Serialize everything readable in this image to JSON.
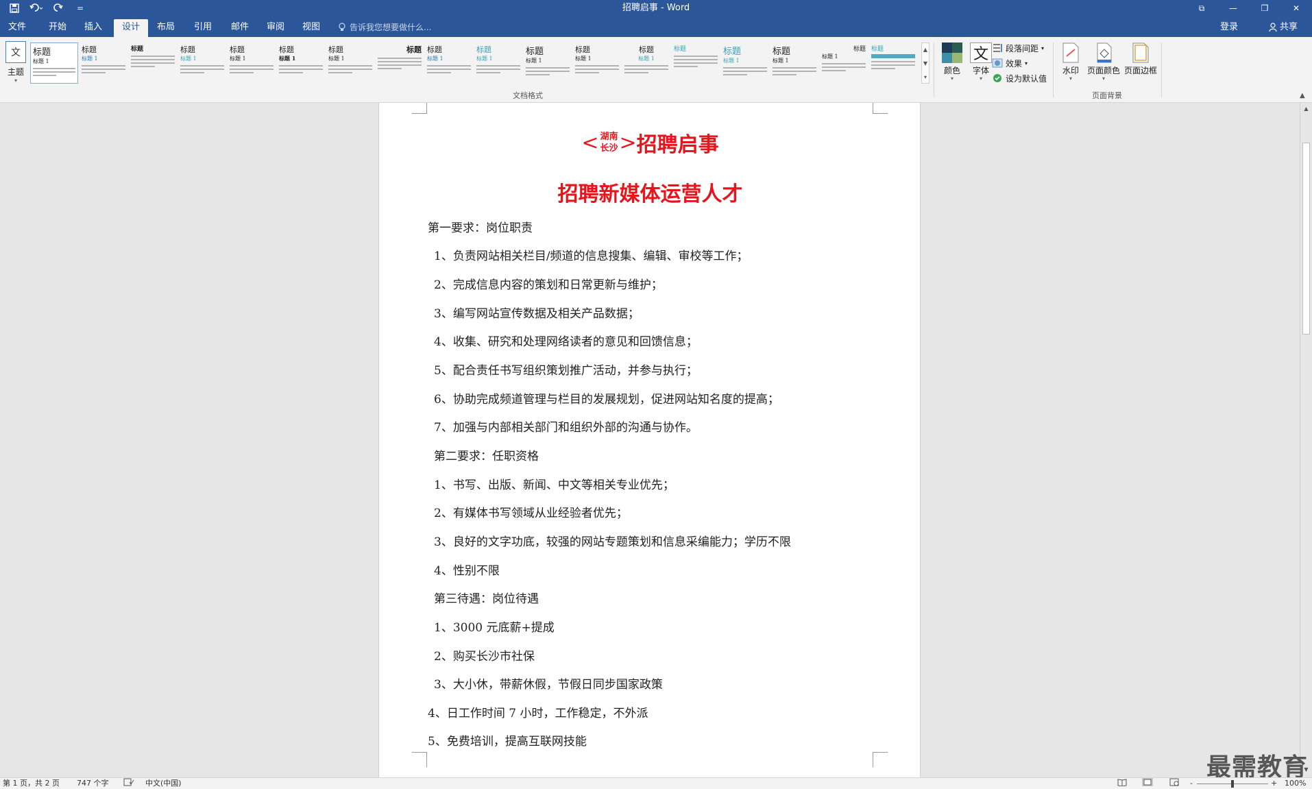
{
  "window": {
    "title": "招聘启事 - Word",
    "minimize": "—",
    "restore": "❐",
    "close": "✕",
    "ribbon_display": "⧉"
  },
  "qat": {
    "save_icon": "save-icon",
    "undo_icon": "undo-icon",
    "redo_icon": "redo-icon",
    "customize": "="
  },
  "tabs": [
    {
      "label": "文件"
    },
    {
      "label": "开始"
    },
    {
      "label": "插入"
    },
    {
      "label": "设计"
    },
    {
      "label": "布局"
    },
    {
      "label": "引用"
    },
    {
      "label": "邮件"
    },
    {
      "label": "审阅"
    },
    {
      "label": "视图"
    }
  ],
  "tellme": {
    "placeholder": "告诉我您想要做什么..."
  },
  "account": {
    "login": "登录",
    "share": "共享"
  },
  "ribbon": {
    "themes_label": "主题",
    "themes_icon_text": "文",
    "style_title": "标题",
    "style_heading1": "标题 1",
    "group_document_format": "文档格式",
    "colors_label": "颜色",
    "fonts_label": "字体",
    "fonts_icon_text": "文",
    "paragraph_spacing": "段落间距",
    "effects": "效果",
    "set_default": "设为默认值",
    "watermark_label": "水印",
    "page_color_label": "页面颜色",
    "page_borders_label": "页面边框",
    "group_page_background": "页面背景"
  },
  "document": {
    "title_prefix_bracket_open": "<",
    "title_combined_top": "湖南",
    "title_combined_bottom": "长沙",
    "title_prefix_bracket_close": ">",
    "title_main": "招聘启事",
    "subtitle": "招聘新媒体运营人才",
    "paragraphs": [
      "第一要求：岗位职责",
      "1、负责网站相关栏目/频道的信息搜集、编辑、审校等工作；",
      "2、完成信息内容的策划和日常更新与维护；",
      "3、编写网站宣传数据及相关产品数据；",
      "4、收集、研究和处理网络读者的意见和回馈信息；",
      "5、配合责任书写组织策划推广活动，并参与执行；",
      "6、协助完成频道管理与栏目的发展规划，促进网站知名度的提高；",
      "7、加强与内部相关部门和组织外部的沟通与协作。",
      "第二要求：任职资格",
      "1、书写、出版、新闻、中文等相关专业优先；",
      "2、有媒体书写领域从业经验者优先；",
      "3、良好的文字功底，较强的网站专题策划和信息采编能力；学历不限",
      "4、性别不限",
      "第三待遇：岗位待遇",
      "1、3000 元底薪+提成",
      "2、购买长沙市社保",
      "3、大小休，带薪休假，节假日同步国家政策",
      "4、日工作时间 7 小时，工作稳定，不外派",
      "5、免费培训，提高互联网技能"
    ]
  },
  "status": {
    "page": "第 1 页，共 2 页",
    "words": "747 个字",
    "language": "中文(中国)",
    "zoom_minus": "-",
    "zoom_plus": "+",
    "zoom": "100%",
    "zoom_level": 1.0
  },
  "watermark_text": "最需教育",
  "colors": {
    "accent": "#2b579a",
    "title_red": "#e8141c"
  }
}
